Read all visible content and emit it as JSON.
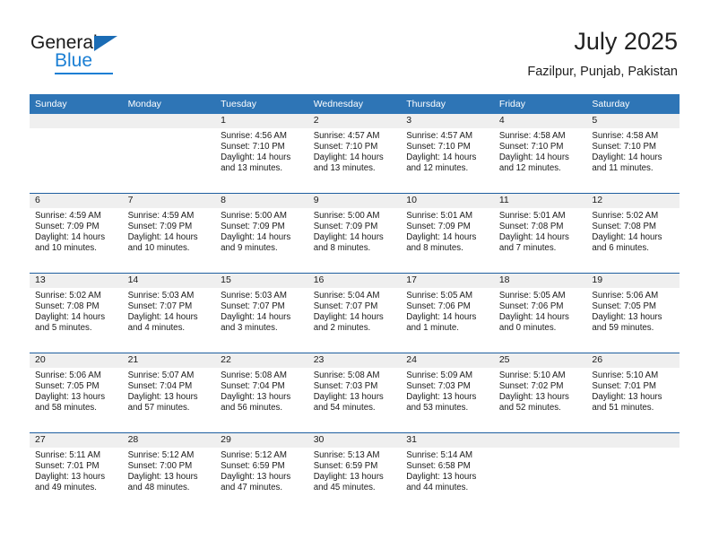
{
  "brand": {
    "name_part1": "General",
    "name_part2": "Blue",
    "triangle_icon": "triangle-icon",
    "accent_color": "#1b7fd4",
    "header_color": "#2e75b6"
  },
  "header": {
    "title": "July 2025",
    "subtitle": "Fazilpur, Punjab, Pakistan"
  },
  "calendar": {
    "weekday_headers": [
      "Sunday",
      "Monday",
      "Tuesday",
      "Wednesday",
      "Thursday",
      "Friday",
      "Saturday"
    ],
    "weeks": [
      [
        {
          "day": "",
          "sunrise": "",
          "sunset": "",
          "daylight1": "",
          "daylight2": ""
        },
        {
          "day": "",
          "sunrise": "",
          "sunset": "",
          "daylight1": "",
          "daylight2": ""
        },
        {
          "day": "1",
          "sunrise": "Sunrise: 4:56 AM",
          "sunset": "Sunset: 7:10 PM",
          "daylight1": "Daylight: 14 hours",
          "daylight2": "and 13 minutes."
        },
        {
          "day": "2",
          "sunrise": "Sunrise: 4:57 AM",
          "sunset": "Sunset: 7:10 PM",
          "daylight1": "Daylight: 14 hours",
          "daylight2": "and 13 minutes."
        },
        {
          "day": "3",
          "sunrise": "Sunrise: 4:57 AM",
          "sunset": "Sunset: 7:10 PM",
          "daylight1": "Daylight: 14 hours",
          "daylight2": "and 12 minutes."
        },
        {
          "day": "4",
          "sunrise": "Sunrise: 4:58 AM",
          "sunset": "Sunset: 7:10 PM",
          "daylight1": "Daylight: 14 hours",
          "daylight2": "and 12 minutes."
        },
        {
          "day": "5",
          "sunrise": "Sunrise: 4:58 AM",
          "sunset": "Sunset: 7:10 PM",
          "daylight1": "Daylight: 14 hours",
          "daylight2": "and 11 minutes."
        }
      ],
      [
        {
          "day": "6",
          "sunrise": "Sunrise: 4:59 AM",
          "sunset": "Sunset: 7:09 PM",
          "daylight1": "Daylight: 14 hours",
          "daylight2": "and 10 minutes."
        },
        {
          "day": "7",
          "sunrise": "Sunrise: 4:59 AM",
          "sunset": "Sunset: 7:09 PM",
          "daylight1": "Daylight: 14 hours",
          "daylight2": "and 10 minutes."
        },
        {
          "day": "8",
          "sunrise": "Sunrise: 5:00 AM",
          "sunset": "Sunset: 7:09 PM",
          "daylight1": "Daylight: 14 hours",
          "daylight2": "and 9 minutes."
        },
        {
          "day": "9",
          "sunrise": "Sunrise: 5:00 AM",
          "sunset": "Sunset: 7:09 PM",
          "daylight1": "Daylight: 14 hours",
          "daylight2": "and 8 minutes."
        },
        {
          "day": "10",
          "sunrise": "Sunrise: 5:01 AM",
          "sunset": "Sunset: 7:09 PM",
          "daylight1": "Daylight: 14 hours",
          "daylight2": "and 8 minutes."
        },
        {
          "day": "11",
          "sunrise": "Sunrise: 5:01 AM",
          "sunset": "Sunset: 7:08 PM",
          "daylight1": "Daylight: 14 hours",
          "daylight2": "and 7 minutes."
        },
        {
          "day": "12",
          "sunrise": "Sunrise: 5:02 AM",
          "sunset": "Sunset: 7:08 PM",
          "daylight1": "Daylight: 14 hours",
          "daylight2": "and 6 minutes."
        }
      ],
      [
        {
          "day": "13",
          "sunrise": "Sunrise: 5:02 AM",
          "sunset": "Sunset: 7:08 PM",
          "daylight1": "Daylight: 14 hours",
          "daylight2": "and 5 minutes."
        },
        {
          "day": "14",
          "sunrise": "Sunrise: 5:03 AM",
          "sunset": "Sunset: 7:07 PM",
          "daylight1": "Daylight: 14 hours",
          "daylight2": "and 4 minutes."
        },
        {
          "day": "15",
          "sunrise": "Sunrise: 5:03 AM",
          "sunset": "Sunset: 7:07 PM",
          "daylight1": "Daylight: 14 hours",
          "daylight2": "and 3 minutes."
        },
        {
          "day": "16",
          "sunrise": "Sunrise: 5:04 AM",
          "sunset": "Sunset: 7:07 PM",
          "daylight1": "Daylight: 14 hours",
          "daylight2": "and 2 minutes."
        },
        {
          "day": "17",
          "sunrise": "Sunrise: 5:05 AM",
          "sunset": "Sunset: 7:06 PM",
          "daylight1": "Daylight: 14 hours",
          "daylight2": "and 1 minute."
        },
        {
          "day": "18",
          "sunrise": "Sunrise: 5:05 AM",
          "sunset": "Sunset: 7:06 PM",
          "daylight1": "Daylight: 14 hours",
          "daylight2": "and 0 minutes."
        },
        {
          "day": "19",
          "sunrise": "Sunrise: 5:06 AM",
          "sunset": "Sunset: 7:05 PM",
          "daylight1": "Daylight: 13 hours",
          "daylight2": "and 59 minutes."
        }
      ],
      [
        {
          "day": "20",
          "sunrise": "Sunrise: 5:06 AM",
          "sunset": "Sunset: 7:05 PM",
          "daylight1": "Daylight: 13 hours",
          "daylight2": "and 58 minutes."
        },
        {
          "day": "21",
          "sunrise": "Sunrise: 5:07 AM",
          "sunset": "Sunset: 7:04 PM",
          "daylight1": "Daylight: 13 hours",
          "daylight2": "and 57 minutes."
        },
        {
          "day": "22",
          "sunrise": "Sunrise: 5:08 AM",
          "sunset": "Sunset: 7:04 PM",
          "daylight1": "Daylight: 13 hours",
          "daylight2": "and 56 minutes."
        },
        {
          "day": "23",
          "sunrise": "Sunrise: 5:08 AM",
          "sunset": "Sunset: 7:03 PM",
          "daylight1": "Daylight: 13 hours",
          "daylight2": "and 54 minutes."
        },
        {
          "day": "24",
          "sunrise": "Sunrise: 5:09 AM",
          "sunset": "Sunset: 7:03 PM",
          "daylight1": "Daylight: 13 hours",
          "daylight2": "and 53 minutes."
        },
        {
          "day": "25",
          "sunrise": "Sunrise: 5:10 AM",
          "sunset": "Sunset: 7:02 PM",
          "daylight1": "Daylight: 13 hours",
          "daylight2": "and 52 minutes."
        },
        {
          "day": "26",
          "sunrise": "Sunrise: 5:10 AM",
          "sunset": "Sunset: 7:01 PM",
          "daylight1": "Daylight: 13 hours",
          "daylight2": "and 51 minutes."
        }
      ],
      [
        {
          "day": "27",
          "sunrise": "Sunrise: 5:11 AM",
          "sunset": "Sunset: 7:01 PM",
          "daylight1": "Daylight: 13 hours",
          "daylight2": "and 49 minutes."
        },
        {
          "day": "28",
          "sunrise": "Sunrise: 5:12 AM",
          "sunset": "Sunset: 7:00 PM",
          "daylight1": "Daylight: 13 hours",
          "daylight2": "and 48 minutes."
        },
        {
          "day": "29",
          "sunrise": "Sunrise: 5:12 AM",
          "sunset": "Sunset: 6:59 PM",
          "daylight1": "Daylight: 13 hours",
          "daylight2": "and 47 minutes."
        },
        {
          "day": "30",
          "sunrise": "Sunrise: 5:13 AM",
          "sunset": "Sunset: 6:59 PM",
          "daylight1": "Daylight: 13 hours",
          "daylight2": "and 45 minutes."
        },
        {
          "day": "31",
          "sunrise": "Sunrise: 5:14 AM",
          "sunset": "Sunset: 6:58 PM",
          "daylight1": "Daylight: 13 hours",
          "daylight2": "and 44 minutes."
        },
        {
          "day": "",
          "sunrise": "",
          "sunset": "",
          "daylight1": "",
          "daylight2": ""
        },
        {
          "day": "",
          "sunrise": "",
          "sunset": "",
          "daylight1": "",
          "daylight2": ""
        }
      ]
    ]
  }
}
